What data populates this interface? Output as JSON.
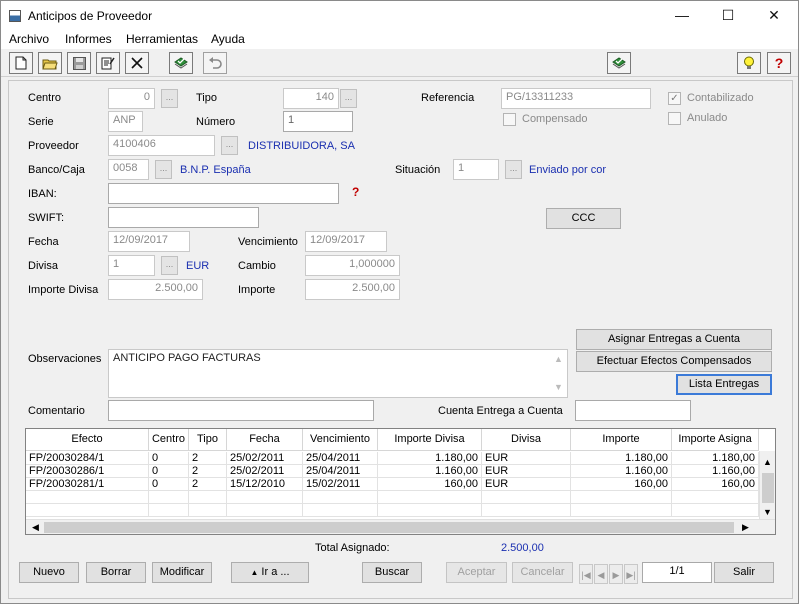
{
  "window": {
    "title": "Anticipos de Proveedor",
    "minimize": "—",
    "maximize": "☐",
    "close": "✕"
  },
  "menu": [
    "Archivo",
    "Informes",
    "Herramientas",
    "Ayuda"
  ],
  "toolbar": {
    "icons": [
      "new-document-icon",
      "open-folder-icon",
      "save-icon",
      "edit-icon",
      "delete-icon",
      "book-check-icon",
      "undo-icon"
    ],
    "right_icons": [
      "book-check-icon",
      "lightbulb-icon",
      "help-icon"
    ]
  },
  "form": {
    "centro": {
      "label": "Centro",
      "value": "0"
    },
    "tipo": {
      "label": "Tipo",
      "value": "140"
    },
    "referencia": {
      "label": "Referencia",
      "value": "PG/13311233"
    },
    "contabilizado": {
      "label": "Contabilizado",
      "checked": true
    },
    "serie": {
      "label": "Serie",
      "value": "ANP"
    },
    "numero": {
      "label": "Número",
      "value": "1"
    },
    "compensado": {
      "label": "Compensado",
      "checked": false
    },
    "anulado": {
      "label": "Anulado",
      "checked": false
    },
    "proveedor": {
      "label": "Proveedor",
      "value": "4100406",
      "name": "DISTRIBUIDORA, SA"
    },
    "banco": {
      "label": "Banco/Caja",
      "value": "0058",
      "name": "B.N.P. España"
    },
    "situacion": {
      "label": "Situación",
      "value": "1",
      "name": "Enviado por cor"
    },
    "iban": {
      "label": "IBAN:",
      "value": ""
    },
    "swift": {
      "label": "SWIFT:",
      "value": ""
    },
    "ccc_button": "CCC",
    "fecha": {
      "label": "Fecha",
      "value": "12/09/2017"
    },
    "vencimiento": {
      "label": "Vencimiento",
      "value": "12/09/2017"
    },
    "divisa": {
      "label": "Divisa",
      "value": "1",
      "name": "EUR"
    },
    "cambio": {
      "label": "Cambio",
      "value": "1,000000"
    },
    "importe_divisa": {
      "label": "Importe Divisa",
      "value": "2.500,00"
    },
    "importe": {
      "label": "Importe",
      "value": "2.500,00"
    },
    "observaciones": {
      "label": "Observaciones",
      "value": "ANTICIPO PAGO FACTURAS"
    },
    "comentario": {
      "label": "Comentario",
      "value": ""
    },
    "cuenta_entrega": {
      "label": "Cuenta Entrega a Cuenta",
      "value": ""
    },
    "buttons": {
      "asignar": "Asignar Entregas a Cuenta",
      "efectuar": "Efectuar Efectos Compensados",
      "lista": "Lista Entregas"
    }
  },
  "grid": {
    "columns": [
      "Efecto",
      "Centro",
      "Tipo",
      "Fecha",
      "Vencimiento",
      "Importe Divisa",
      "Divisa",
      "Importe",
      "Importe Asigna"
    ],
    "rows": [
      [
        "FP/20030284/1",
        "0",
        "2",
        "25/02/2011",
        "25/04/2011",
        "1.180,00",
        "EUR",
        "1.180,00",
        "1.180,00"
      ],
      [
        "FP/20030286/1",
        "0",
        "2",
        "25/02/2011",
        "25/04/2011",
        "1.160,00",
        "EUR",
        "1.160,00",
        "1.160,00"
      ],
      [
        "FP/20030281/1",
        "0",
        "2",
        "15/12/2010",
        "15/02/2011",
        "160,00",
        "EUR",
        "160,00",
        "160,00"
      ]
    ]
  },
  "total": {
    "label": "Total Asignado:",
    "value": "2.500,00"
  },
  "footer": {
    "nuevo": "Nuevo",
    "borrar": "Borrar",
    "modificar": "Modificar",
    "ir_a": "Ir a ...",
    "buscar": "Buscar",
    "aceptar": "Aceptar",
    "cancelar": "Cancelar",
    "page": "1/1",
    "salir": "Salir"
  }
}
